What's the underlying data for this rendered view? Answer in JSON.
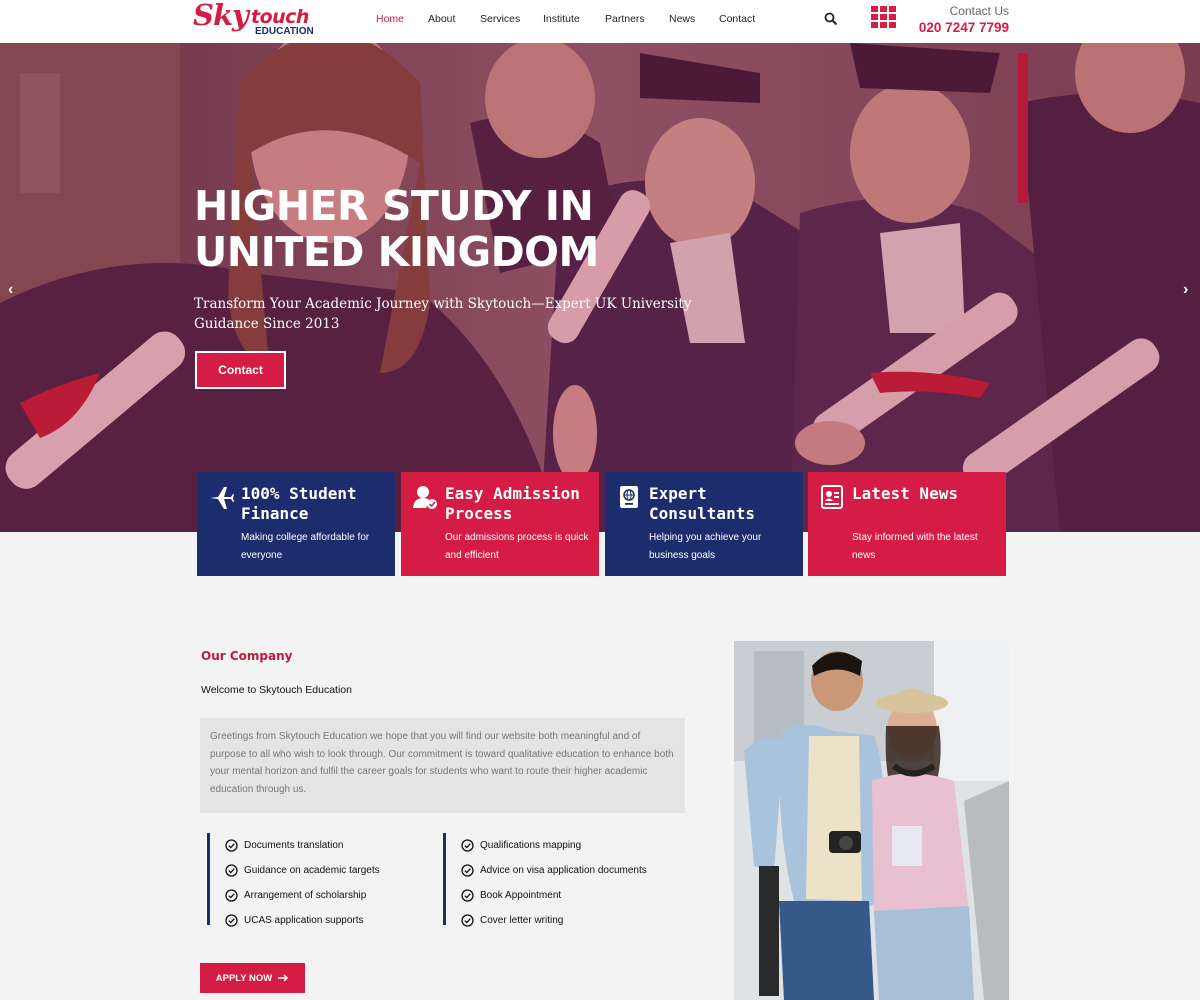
{
  "brand": {
    "logo_sky": "Sky",
    "logo_touch": "touch",
    "logo_edu": "EDUCATION"
  },
  "nav": {
    "items": [
      "Home",
      "About",
      "Services",
      "Institute",
      "Partners",
      "News",
      "Contact"
    ],
    "active": "Home"
  },
  "header": {
    "contact_label": "Contact Us",
    "phone": "020 7247 7799"
  },
  "hero": {
    "title_line1": "HIGHER STUDY IN",
    "title_line2": "UNITED KINGDOM",
    "subtitle": "Transform Your Academic Journey with Skytouch—Expert UK University Guidance Since 2013",
    "button": "Contact",
    "prev_arrow": "‹",
    "next_arrow": "›"
  },
  "features": [
    {
      "title": "100% Student Finance",
      "desc": "Making college affordable for everyone",
      "color": "#1c2d6e",
      "icon": "airplane-icon"
    },
    {
      "title": "Easy Admission Process",
      "desc": "Our admissions process is quick and efficient",
      "color": "#d41c45",
      "icon": "user-admission-icon"
    },
    {
      "title": "Expert Consultants",
      "desc": "Helping you achieve your business goals",
      "color": "#1c2d6e",
      "icon": "passport-globe-icon"
    },
    {
      "title": "Latest News",
      "desc": "Stay informed with the latest news",
      "color": "#d41c45",
      "icon": "news-icon"
    }
  ],
  "about": {
    "heading": "Our Company",
    "welcome": "Welcome to Skytouch Education",
    "intro": "Greetings from Skytouch Education we hope that you will find our website both meaningful and of purpose to all who wish to look through. Our commitment is toward qualitative education to enhance both your mental horizon and fulfil the career goals for students who want to route their higher academic education through us.",
    "list_left": [
      "Documents translation",
      "Guidance on academic targets",
      "Arrangement of scholarship",
      "UCAS application supports"
    ],
    "list_right": [
      "Qualifications mapping",
      "Advice on visa application documents",
      "Book Appointment",
      "Cover letter writing"
    ],
    "apply_button": "APPLY NOW"
  },
  "colors": {
    "accent": "#d41c45",
    "navy": "#1c2d6e",
    "background": "#f2f3f2"
  }
}
